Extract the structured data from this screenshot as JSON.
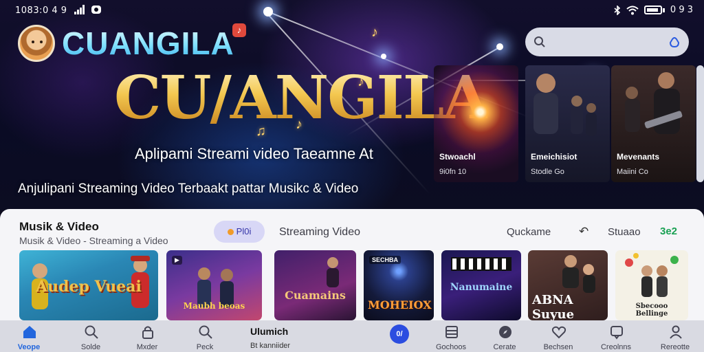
{
  "status_bar": {
    "time": "1083:0 4 9",
    "battery_text": "0 9 3"
  },
  "header": {
    "app_name": "CUANGILA",
    "logo_badge": "♪",
    "search": {
      "placeholder": "",
      "icon": "search-icon",
      "action_icon": "mic-icon"
    }
  },
  "hero": {
    "title": "CU/ANGILA",
    "subtitle": "Aplipami Streami video Taeamne At",
    "tagline": "Anjulipani Streaming Video Terbaakt pattar Musikc & Video",
    "cards": [
      {
        "title": "Stwoachl",
        "meta": "9i0fn 10"
      },
      {
        "title": "Emeichisiot",
        "meta": "Stodle Go"
      },
      {
        "title": "Mevenants",
        "meta": "Maiini Co"
      },
      {
        "title": "",
        "meta": ""
      }
    ]
  },
  "section": {
    "title": "Musik & Video",
    "subtitle": "Musik & Video  -  Streaming a Video",
    "chips": {
      "active": "Pl0i",
      "streaming": "Streaming Video",
      "quick": "Quckame",
      "studio": "Stuaao",
      "count": "3e2"
    },
    "thumbnails": [
      {
        "tag": "",
        "text": "Audep Vueai"
      },
      {
        "tag": "▶",
        "text": "Maubh beoas"
      },
      {
        "tag": "",
        "text": "Cuamains"
      },
      {
        "tag": "SECHBA",
        "text": "MOHEIOX"
      },
      {
        "tag": "",
        "text": "Nanumaine"
      },
      {
        "tag": "",
        "text": "ABNA Suyue"
      },
      {
        "tag": "",
        "text": "Sbecooo Bellinge"
      }
    ]
  },
  "bottom_nav": {
    "items": [
      {
        "label": "Veope",
        "icon": "home-icon",
        "active": true
      },
      {
        "label": "Solde",
        "icon": "search-icon",
        "active": false
      },
      {
        "label": "Mxder",
        "icon": "lock-icon",
        "active": false
      },
      {
        "label": "Peck",
        "icon": "search-icon",
        "active": false
      },
      {
        "label": "Gochoos",
        "icon": "grid-icon",
        "active": false
      },
      {
        "label": "Cerate",
        "icon": "compass-icon",
        "active": false
      },
      {
        "label": "Bechsen",
        "icon": "heart-icon",
        "active": false
      },
      {
        "label": "Creolnns",
        "icon": "chat-icon",
        "active": false
      },
      {
        "label": "Rereotte",
        "icon": "user-icon",
        "active": false
      }
    ],
    "center_title": "Ulumich",
    "center_sub": "Bt kanniider",
    "center_fab": "0/"
  },
  "colors": {
    "accent": "#2b4de0",
    "logo": "#7fe0ff",
    "hero_gold": "#f3c74f",
    "panel": "#f5f5f8",
    "nav": "#d9dae2",
    "chip_active_bg": "#d8d7f6",
    "count_green": "#18a052"
  }
}
